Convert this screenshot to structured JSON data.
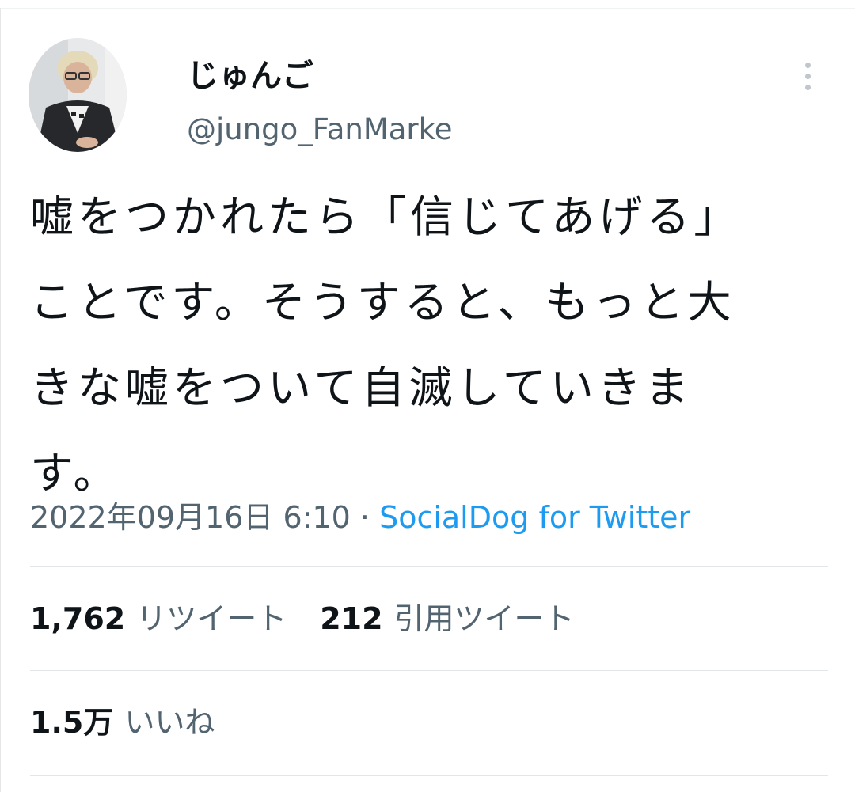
{
  "tweet": {
    "author": {
      "display_name": "じゅんご",
      "handle": "@jungo_FanMarke"
    },
    "text_lines": [
      "嘘をつかれたら「信じてあげる」",
      "ことです。そうすると、もっと大",
      "きな嘘をついて自滅していきま",
      "す。"
    ],
    "timestamp": "2022年09月16日 6:10",
    "separator": " · ",
    "source": "SocialDog for Twitter",
    "stats": {
      "retweets_count": "1,762",
      "retweets_label": "リツイート",
      "quotes_count": "212",
      "quotes_label": "引用ツイート",
      "likes_count": "1.5万",
      "likes_label": "いいね"
    }
  },
  "icons": {
    "more": "more-vertical-icon"
  },
  "colors": {
    "text": "#0f1419",
    "secondary": "#536471",
    "link": "#1d9bf0",
    "divider": "#e3e6e8"
  }
}
